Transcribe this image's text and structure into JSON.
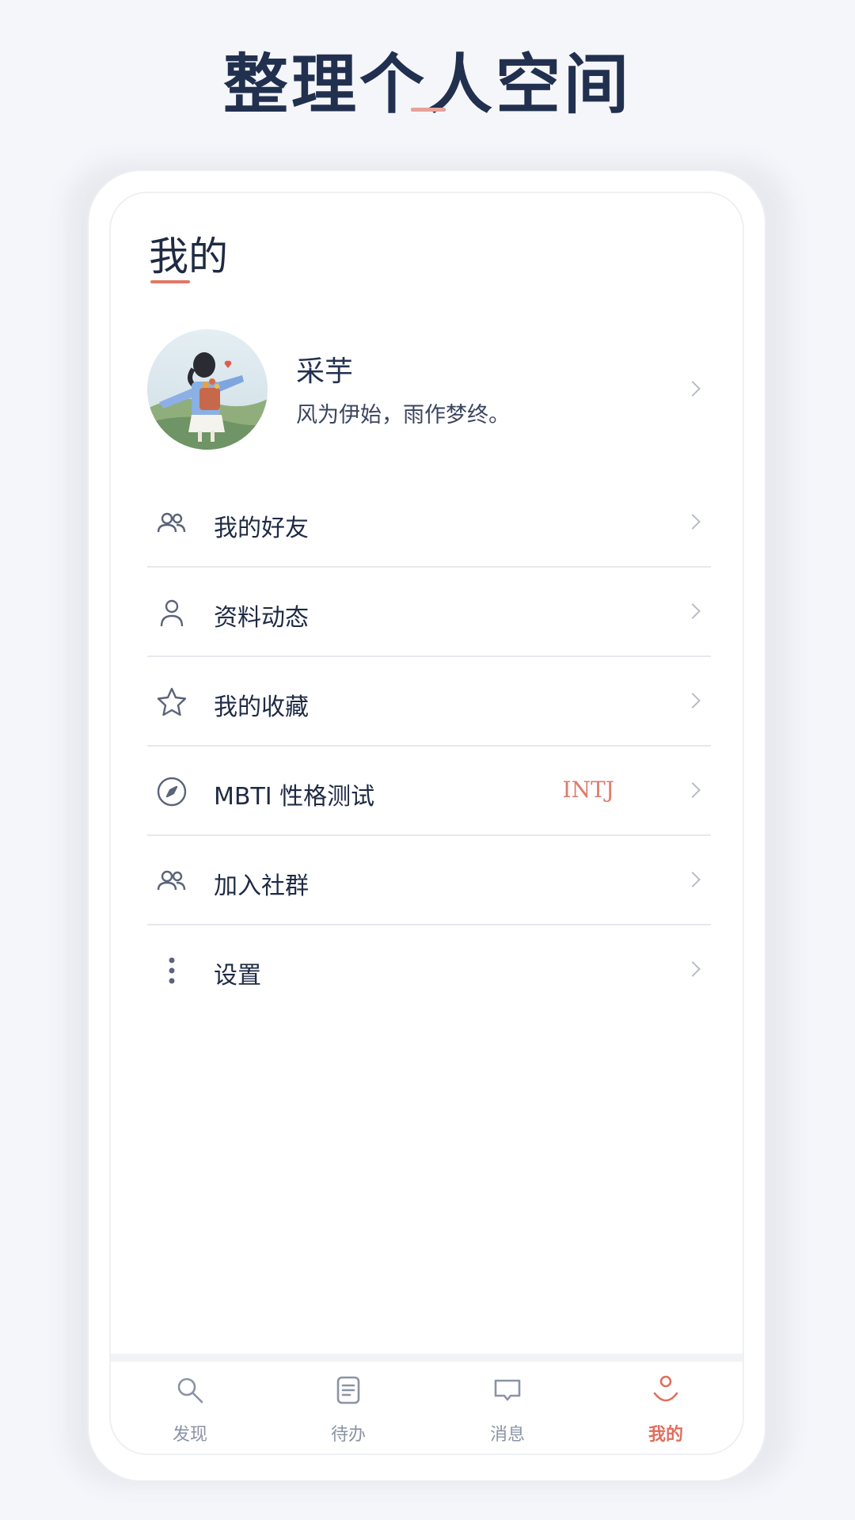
{
  "headline": "整理个人空间",
  "page": {
    "title": "我的"
  },
  "profile": {
    "name": "采芋",
    "motto": "风为伊始，雨作梦终。"
  },
  "menu": [
    {
      "icon": "friends-icon",
      "label": "我的好友",
      "value": ""
    },
    {
      "icon": "person-icon",
      "label": "资料动态",
      "value": ""
    },
    {
      "icon": "star-icon",
      "label": "我的收藏",
      "value": ""
    },
    {
      "icon": "compass-icon",
      "label": "MBTI 性格测试",
      "value": "INTJ"
    },
    {
      "icon": "group-icon",
      "label": "加入社群",
      "value": ""
    },
    {
      "icon": "more-vertical-icon",
      "label": "设置",
      "value": ""
    }
  ],
  "tabs": [
    {
      "icon": "search-icon",
      "label": "发现",
      "active": false
    },
    {
      "icon": "todo-icon",
      "label": "待办",
      "active": false
    },
    {
      "icon": "message-icon",
      "label": "消息",
      "active": false
    },
    {
      "icon": "profile-smile-icon",
      "label": "我的",
      "active": true
    }
  ],
  "colors": {
    "accent": "#df6f5e",
    "text": "#1f2a44",
    "icon": "#5b6478",
    "background": "#f4f6fa"
  }
}
